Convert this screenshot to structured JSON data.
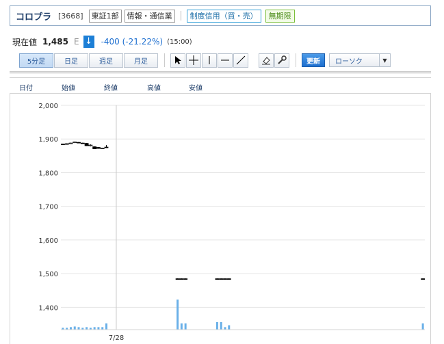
{
  "header": {
    "company": "コロプラ",
    "code": "[3668]",
    "market": "東証1部",
    "industry": "情報・通信業",
    "margin_type": "制度信用（買・売）",
    "term": "無期限"
  },
  "price": {
    "label": "現在値",
    "value": "1,485",
    "market_flag": "E",
    "change": "-400 (-21.22%)",
    "time": "(15:00)"
  },
  "toolbar": {
    "periods": [
      "5分足",
      "日足",
      "週足",
      "月足"
    ],
    "active_period": "5分足",
    "update_label": "更新",
    "chart_type": "ローソク"
  },
  "columns": [
    "日付",
    "始値",
    "終値",
    "高値",
    "安値"
  ],
  "colors": {
    "accent": "#1d7fd6",
    "volume": "#6ab0e8",
    "grid": "#e4e4e4",
    "candle": "#000000"
  },
  "chart_data": {
    "type": "candlestick",
    "ylim": [
      1350,
      2000
    ],
    "y_ticks": [
      2000,
      1900,
      1800,
      1700,
      1600,
      1500,
      1400
    ],
    "y_tick_labels": [
      "2,000",
      "1,900",
      "1,800",
      "1,700",
      "1,600",
      "1,500",
      "1,400"
    ],
    "x_tick_labels": [
      {
        "index": 14,
        "label": "7/28"
      }
    ],
    "n_slots": 92,
    "candles": [
      {
        "i": 0,
        "o": 1885,
        "c": 1885,
        "h": 1886,
        "l": 1884
      },
      {
        "i": 1,
        "o": 1886,
        "c": 1886,
        "h": 1887,
        "l": 1885
      },
      {
        "i": 2,
        "o": 1887,
        "c": 1888,
        "h": 1889,
        "l": 1886
      },
      {
        "i": 3,
        "o": 1889,
        "c": 1891,
        "h": 1892,
        "l": 1888
      },
      {
        "i": 4,
        "o": 1890,
        "c": 1889,
        "h": 1891,
        "l": 1888
      },
      {
        "i": 5,
        "o": 1888,
        "c": 1887,
        "h": 1889,
        "l": 1886
      },
      {
        "i": 6,
        "o": 1887,
        "c": 1880,
        "h": 1888,
        "l": 1879
      },
      {
        "i": 7,
        "o": 1880,
        "c": 1882,
        "h": 1884,
        "l": 1878
      },
      {
        "i": 8,
        "o": 1877,
        "c": 1871,
        "h": 1878,
        "l": 1870
      },
      {
        "i": 9,
        "o": 1875,
        "c": 1872,
        "h": 1876,
        "l": 1871
      },
      {
        "i": 10,
        "o": 1872,
        "c": 1873,
        "h": 1874,
        "l": 1871
      },
      {
        "i": 11,
        "o": 1876,
        "c": 1876,
        "h": 1882,
        "l": 1873
      },
      {
        "i": 29,
        "o": 1485,
        "c": 1485,
        "h": 1486,
        "l": 1484
      },
      {
        "i": 30,
        "o": 1485,
        "c": 1485,
        "h": 1486,
        "l": 1484
      },
      {
        "i": 31,
        "o": 1485,
        "c": 1485,
        "h": 1486,
        "l": 1484
      },
      {
        "i": 39,
        "o": 1485,
        "c": 1485,
        "h": 1486,
        "l": 1484
      },
      {
        "i": 40,
        "o": 1485,
        "c": 1485,
        "h": 1486,
        "l": 1484
      },
      {
        "i": 41,
        "o": 1485,
        "c": 1485,
        "h": 1486,
        "l": 1484
      },
      {
        "i": 42,
        "o": 1485,
        "c": 1485,
        "h": 1486,
        "l": 1484
      },
      {
        "i": 91,
        "o": 1485,
        "c": 1485,
        "h": 1486,
        "l": 1484
      }
    ],
    "volume": [
      {
        "i": 0,
        "v": 3
      },
      {
        "i": 1,
        "v": 3
      },
      {
        "i": 2,
        "v": 4
      },
      {
        "i": 3,
        "v": 5
      },
      {
        "i": 4,
        "v": 4
      },
      {
        "i": 5,
        "v": 3
      },
      {
        "i": 6,
        "v": 4
      },
      {
        "i": 7,
        "v": 3
      },
      {
        "i": 8,
        "v": 4
      },
      {
        "i": 9,
        "v": 4
      },
      {
        "i": 10,
        "v": 4
      },
      {
        "i": 11,
        "v": 10
      },
      {
        "i": 29,
        "v": 48
      },
      {
        "i": 30,
        "v": 10
      },
      {
        "i": 31,
        "v": 10
      },
      {
        "i": 39,
        "v": 12
      },
      {
        "i": 40,
        "v": 12
      },
      {
        "i": 41,
        "v": 4
      },
      {
        "i": 42,
        "v": 7
      },
      {
        "i": 91,
        "v": 10
      }
    ],
    "volume_max": 60
  }
}
